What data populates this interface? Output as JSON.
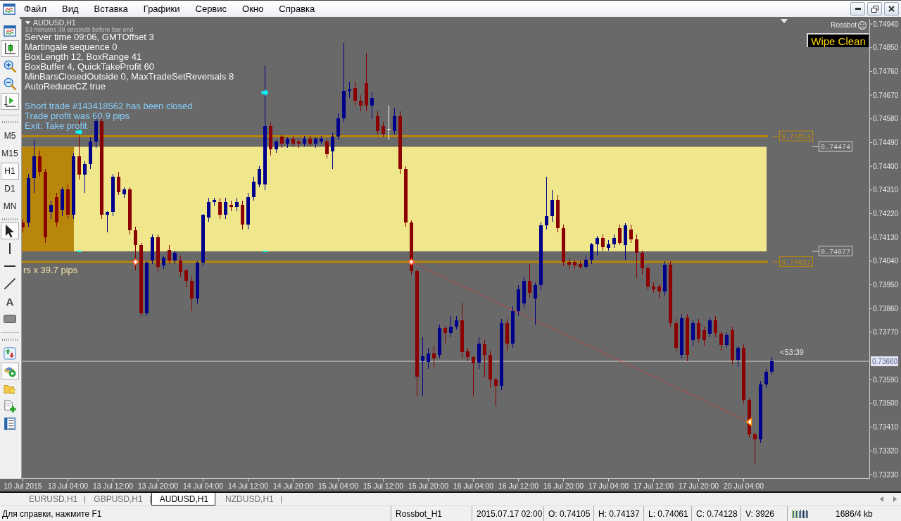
{
  "menu_bar": {
    "items": [
      "Файл",
      "Вид",
      "Вставка",
      "Графики",
      "Сервис",
      "Окно",
      "Справка"
    ]
  },
  "toolbar": {
    "chart_buttons": [
      {
        "kind": "window",
        "pressed": false
      },
      {
        "kind": "candles",
        "pressed": true
      },
      {
        "kind": "zoomin",
        "pressed": false
      },
      {
        "kind": "zoomout",
        "pressed": false
      },
      {
        "kind": "shift",
        "pressed": true
      }
    ],
    "timeframes": [
      {
        "label": "M5",
        "selected": false
      },
      {
        "label": "M15",
        "selected": false
      },
      {
        "label": "H1",
        "selected": true
      },
      {
        "label": "D1",
        "selected": false
      },
      {
        "label": "MN",
        "selected": false
      }
    ],
    "draw_tools": [
      {
        "kind": "cursor",
        "selected": true
      },
      {
        "kind": "vline",
        "selected": false
      },
      {
        "kind": "hline",
        "selected": false
      },
      {
        "kind": "trend",
        "selected": false
      },
      {
        "kind": "text",
        "label": "A",
        "selected": false
      },
      {
        "kind": "rect",
        "selected": false
      }
    ],
    "panel_buttons": [
      {
        "kind": "arrows",
        "pressed": false
      },
      {
        "kind": "tester",
        "pressed": true
      },
      {
        "kind": "favorites",
        "pressed": false
      },
      {
        "kind": "newdoc",
        "pressed": false
      },
      {
        "kind": "list",
        "pressed": false
      }
    ]
  },
  "chart": {
    "symbol": "AUDUSD,H1",
    "countdown": "53 minutes 38 seconds before bar end",
    "info_lines": [
      "Server time 09:06, GMTOffset 3",
      "Martingale sequence 0",
      "BoxLength 12, BoxRange 41",
      "BoxBuffer 4, QuickTakeProfit 60",
      "MinBarsClosedOutside 0, MaxTradeSetReversals 8",
      "AutoReduceCZ true"
    ],
    "trade_lines": [
      "Short trade #143418562 has been closed",
      "Trade profit was 60.9 pips",
      "Exit: Take profit"
    ],
    "box_note": "rs x 39.7 pips",
    "robot": "Rossbot",
    "wipe_button": "Wipe Clean",
    "bar_timer": "<53:39",
    "chart_data": [
      {
        "type": "candlestick",
        "ylim": [
          0.73214,
          0.74959
        ],
        "yticks": [
          {
            "value": 0.7494,
            "label": "0.74940"
          },
          {
            "value": 0.7485,
            "label": "0.74850"
          },
          {
            "value": 0.7476,
            "label": "0.74760"
          },
          {
            "value": 0.7467,
            "label": "0.74670"
          },
          {
            "value": 0.7458,
            "label": "0.74580"
          },
          {
            "value": 0.7449,
            "label": "0.74490"
          },
          {
            "value": 0.744,
            "label": "0.74400"
          },
          {
            "value": 0.7431,
            "label": "0.74310"
          },
          {
            "value": 0.7422,
            "label": "0.74220"
          },
          {
            "value": 0.7413,
            "label": "0.74130"
          },
          {
            "value": 0.7404,
            "label": "0.74040"
          },
          {
            "value": 0.7395,
            "label": "0.73950"
          },
          {
            "value": 0.7386,
            "label": "0.73860"
          },
          {
            "value": 0.7377,
            "label": "0.73770"
          },
          {
            "value": 0.7359,
            "label": "0.73590"
          },
          {
            "value": 0.735,
            "label": "0.73500"
          },
          {
            "value": 0.7341,
            "label": "0.73410"
          },
          {
            "value": 0.7332,
            "label": "0.73320"
          },
          {
            "value": 0.7323,
            "label": "0.73230"
          }
        ],
        "categories": [
          "10 Jul 2015",
          null,
          null,
          null,
          null,
          null,
          null,
          null,
          "13 Jul 04:00",
          null,
          null,
          null,
          null,
          null,
          null,
          null,
          "13 Jul 12:00",
          null,
          null,
          null,
          null,
          null,
          null,
          null,
          "13 Jul 20:00",
          null,
          null,
          null,
          null,
          null,
          null,
          null,
          "14 Jul 04:00",
          null,
          null,
          null,
          null,
          null,
          null,
          null,
          "14 Jul 12:00",
          null,
          null,
          null,
          null,
          null,
          null,
          null,
          "14 Jul 20:00",
          null,
          null,
          null,
          null,
          null,
          null,
          null,
          "15 Jul 04:00",
          null,
          null,
          null,
          null,
          null,
          null,
          null,
          "15 Jul 12:00",
          null,
          null,
          null,
          null,
          null,
          null,
          null,
          "15 Jul 20:00",
          null,
          null,
          null,
          null,
          null,
          null,
          null,
          "16 Jul 04:00",
          null,
          null,
          null,
          null,
          null,
          null,
          null,
          "16 Jul 12:00",
          null,
          null,
          null,
          null,
          null,
          null,
          null,
          "16 Jul 20:00",
          null,
          null,
          null,
          null,
          null,
          null,
          null,
          "17 Jul 04:00",
          null,
          null,
          null,
          null,
          null,
          null,
          null,
          "17 Jul 12:00",
          null,
          null,
          null,
          null,
          null,
          null,
          null,
          "17 Jul 20:00",
          null,
          null,
          null,
          null,
          null,
          null,
          null,
          "20 Jul 04:00",
          null,
          null,
          null,
          null,
          null,
          null,
          null,
          null,
          null,
          null,
          null,
          null,
          null,
          null,
          null,
          null,
          null,
          null,
          null,
          null,
          null,
          null,
          null,
          null,
          null,
          null,
          null
        ],
        "ohlc": [
          [
            0.74187,
            0.742,
            0.7415,
            0.74168
          ],
          [
            0.74187,
            0.7437,
            0.7417,
            0.74356
          ],
          [
            0.74356,
            0.745,
            0.743,
            0.74437
          ],
          [
            0.74437,
            0.7446,
            0.7436,
            0.74379
          ],
          [
            0.74379,
            0.7439,
            0.7411,
            0.7413
          ],
          [
            0.74226,
            0.7427,
            0.742,
            0.74254
          ],
          [
            0.74283,
            0.743,
            0.7417,
            0.74187
          ],
          [
            0.74235,
            0.7432,
            0.7421,
            0.74312
          ],
          [
            0.74312,
            0.7433,
            0.742,
            0.74216
          ],
          [
            0.74216,
            0.7445,
            0.742,
            0.74437
          ],
          [
            0.74437,
            0.74575,
            0.7435,
            0.74369
          ],
          [
            0.74369,
            0.7442,
            0.743,
            0.74408
          ],
          [
            0.74408,
            0.7451,
            0.7439,
            0.74494
          ],
          [
            0.74494,
            0.746,
            0.7447,
            0.74571
          ],
          [
            0.74571,
            0.7459,
            0.742,
            0.74216
          ],
          [
            0.74216,
            0.7423,
            0.74149,
            0.74226
          ],
          [
            0.74226,
            0.7437,
            0.7421,
            0.7436
          ],
          [
            0.7436,
            0.7438,
            0.7429,
            0.74302
          ],
          [
            0.74293,
            0.7432,
            0.7428,
            0.74312
          ],
          [
            0.74312,
            0.7432,
            0.7414,
            0.74158
          ],
          [
            0.74158,
            0.7417,
            0.74005,
            0.74101
          ],
          [
            0.74101,
            0.7411,
            0.7383,
            0.73842
          ],
          [
            0.73842,
            0.7404,
            0.7383,
            0.74034
          ],
          [
            0.74043,
            0.7414,
            0.7403,
            0.7413
          ],
          [
            0.7413,
            0.7414,
            0.74,
            0.74018
          ],
          [
            0.74024,
            0.7406,
            0.7401,
            0.74053
          ],
          [
            0.74082,
            0.741,
            0.7403,
            0.74043
          ],
          [
            0.74043,
            0.7408,
            0.7403,
            0.74072
          ],
          [
            0.74043,
            0.7406,
            0.7398,
            0.73999
          ],
          [
            0.74005,
            0.7401,
            0.7394,
            0.73966
          ],
          [
            0.73966,
            0.7398,
            0.7385,
            0.73899
          ],
          [
            0.73899,
            0.7404,
            0.7388,
            0.74034
          ],
          [
            0.74034,
            0.7422,
            0.7402,
            0.74216
          ],
          [
            0.74206,
            0.7428,
            0.7419,
            0.74264
          ],
          [
            0.74264,
            0.7428,
            0.7425,
            0.74273
          ],
          [
            0.74264,
            0.7428,
            0.742,
            0.74216
          ],
          [
            0.74216,
            0.7428,
            0.742,
            0.74264
          ],
          [
            0.74254,
            0.7427,
            0.7423,
            0.74245
          ],
          [
            0.74245,
            0.7428,
            0.7423,
            0.74264
          ],
          [
            0.74254,
            0.7427,
            0.7416,
            0.74178
          ],
          [
            0.74178,
            0.743,
            0.7416,
            0.74283
          ],
          [
            0.74283,
            0.7436,
            0.7427,
            0.74341
          ],
          [
            0.74331,
            0.744,
            0.7432,
            0.74389
          ],
          [
            0.74331,
            0.74782,
            0.7431,
            0.74552
          ],
          [
            0.74552,
            0.7457,
            0.7444,
            0.74465
          ],
          [
            0.74465,
            0.745,
            0.7445,
            0.74494
          ],
          [
            0.74513,
            0.7452,
            0.7447,
            0.74485
          ],
          [
            0.74485,
            0.7451,
            0.7447,
            0.74504
          ],
          [
            0.74504,
            0.74515,
            0.74475,
            0.74485
          ],
          [
            0.74494,
            0.74505,
            0.7447,
            0.74485
          ],
          [
            0.74485,
            0.74515,
            0.74475,
            0.74504
          ],
          [
            0.74504,
            0.74515,
            0.74475,
            0.74485
          ],
          [
            0.74485,
            0.7451,
            0.7447,
            0.74504
          ],
          [
            0.74494,
            0.74515,
            0.74485,
            0.74504
          ],
          [
            0.74494,
            0.74505,
            0.7443,
            0.74446
          ],
          [
            0.74456,
            0.74525,
            0.7439,
            0.74513
          ],
          [
            0.74513,
            0.746,
            0.745,
            0.74581
          ],
          [
            0.74581,
            0.74868,
            0.7457,
            0.74686
          ],
          [
            0.74686,
            0.7472,
            0.7466,
            0.74692
          ],
          [
            0.74696,
            0.7472,
            0.7463,
            0.74648
          ],
          [
            0.74648,
            0.7467,
            0.7461,
            0.74629
          ],
          [
            0.74715,
            0.7483,
            0.7461,
            0.74629
          ],
          [
            0.74629,
            0.7468,
            0.7458,
            0.7466
          ],
          [
            0.7459,
            0.7461,
            0.7452,
            0.74533
          ],
          [
            0.74552,
            0.7457,
            0.7451,
            0.74523
          ],
          [
            0.74542,
            0.7463,
            0.745,
            0.74542
          ],
          [
            0.74533,
            0.7462,
            0.7452,
            0.7459
          ],
          [
            0.7459,
            0.7461,
            0.7437,
            0.74389
          ],
          [
            0.74389,
            0.744,
            0.7417,
            0.74187
          ],
          [
            0.74188,
            0.74195,
            0.7399,
            0.74003
          ],
          [
            0.74003,
            0.7401,
            0.73527,
            0.73601
          ],
          [
            0.7366,
            0.7375,
            0.73527,
            0.7368
          ],
          [
            0.73657,
            0.7371,
            0.7363,
            0.7369
          ],
          [
            0.7369,
            0.7372,
            0.7364,
            0.7367
          ],
          [
            0.73684,
            0.738,
            0.7367,
            0.73786
          ],
          [
            0.73786,
            0.73795,
            0.7373,
            0.73768
          ],
          [
            0.73768,
            0.7383,
            0.7375,
            0.7379
          ],
          [
            0.7379,
            0.7383,
            0.7378,
            0.73814
          ],
          [
            0.73814,
            0.73883,
            0.7367,
            0.73694
          ],
          [
            0.73697,
            0.7371,
            0.7366,
            0.73675
          ],
          [
            0.73675,
            0.7368,
            0.73527,
            0.73653
          ],
          [
            0.73656,
            0.7375,
            0.7363,
            0.73727
          ],
          [
            0.73725,
            0.7374,
            0.736,
            0.73684
          ],
          [
            0.73684,
            0.737,
            0.7356,
            0.73592
          ],
          [
            0.73592,
            0.736,
            0.7349,
            0.73568
          ],
          [
            0.73568,
            0.7382,
            0.7355,
            0.73805
          ],
          [
            0.73805,
            0.7382,
            0.737,
            0.73727
          ],
          [
            0.73727,
            0.7387,
            0.7371,
            0.73851
          ],
          [
            0.73851,
            0.7395,
            0.7383,
            0.73934
          ],
          [
            0.7388,
            0.7398,
            0.7386,
            0.73966
          ],
          [
            0.73966,
            0.7403,
            0.739,
            0.7392
          ],
          [
            0.73897,
            0.7396,
            0.738,
            0.73949
          ],
          [
            0.73949,
            0.7419,
            0.7393,
            0.74175
          ],
          [
            0.74175,
            0.7436,
            0.7416,
            0.74212
          ],
          [
            0.74212,
            0.7431,
            0.7419,
            0.74271
          ],
          [
            0.74271,
            0.7429,
            0.7415,
            0.74166
          ],
          [
            0.74166,
            0.7418,
            0.7402,
            0.74036
          ],
          [
            0.74036,
            0.7405,
            0.7401,
            0.74027
          ],
          [
            0.74036,
            0.74045,
            0.7401,
            0.74023
          ],
          [
            0.7403,
            0.7404,
            0.7401,
            0.74018
          ],
          [
            0.74018,
            0.7406,
            0.7401,
            0.74045
          ],
          [
            0.74045,
            0.7411,
            0.7403,
            0.74105
          ],
          [
            0.74105,
            0.74137,
            0.74061,
            0.74128
          ],
          [
            0.74129,
            0.7414,
            0.7408,
            0.74092
          ],
          [
            0.7409,
            0.7412,
            0.7408,
            0.74105
          ],
          [
            0.74105,
            0.7414,
            0.7409,
            0.74129
          ],
          [
            0.74166,
            0.7418,
            0.741,
            0.7411
          ],
          [
            0.74101,
            0.74185,
            0.74045,
            0.74175
          ],
          [
            0.7416,
            0.7418,
            0.7411,
            0.74123
          ],
          [
            0.74123,
            0.7414,
            0.73975,
            0.74073
          ],
          [
            0.74073,
            0.7408,
            0.7399,
            0.74012
          ],
          [
            0.74012,
            0.7402,
            0.7393,
            0.73944
          ],
          [
            0.73944,
            0.7396,
            0.7392,
            0.73934
          ],
          [
            0.73944,
            0.73955,
            0.73897,
            0.73925
          ],
          [
            0.73925,
            0.7404,
            0.7391,
            0.74027
          ],
          [
            0.74027,
            0.7404,
            0.7379,
            0.73805
          ],
          [
            0.73805,
            0.7382,
            0.737,
            0.73712
          ],
          [
            0.73684,
            0.7384,
            0.7367,
            0.73823
          ],
          [
            0.73827,
            0.7384,
            0.7366,
            0.73684
          ],
          [
            0.7374,
            0.73815,
            0.7372,
            0.73805
          ],
          [
            0.73805,
            0.7382,
            0.7373,
            0.73746
          ],
          [
            0.73777,
            0.7379,
            0.7372,
            0.7374
          ],
          [
            0.73764,
            0.73825,
            0.7375,
            0.73814
          ],
          [
            0.73814,
            0.7383,
            0.7375,
            0.73768
          ],
          [
            0.73764,
            0.73775,
            0.737,
            0.73721
          ],
          [
            0.73721,
            0.7377,
            0.7371,
            0.73758
          ],
          [
            0.73777,
            0.7379,
            0.7365,
            0.73666
          ],
          [
            0.73666,
            0.7372,
            0.7364,
            0.73712
          ],
          [
            0.73712,
            0.73725,
            0.735,
            0.73512
          ],
          [
            0.73512,
            0.7352,
            0.7337,
            0.73382
          ],
          [
            0.73382,
            0.7339,
            0.73268,
            0.73364
          ],
          [
            0.73364,
            0.73585,
            0.7335,
            0.73573
          ],
          [
            0.73573,
            0.7363,
            0.7356,
            0.7362
          ],
          [
            0.7362,
            0.73675,
            0.7361,
            0.7366
          ],
          null,
          null,
          null,
          null,
          null,
          null,
          null,
          null,
          null,
          null,
          null,
          null,
          null,
          null,
          null,
          null,
          null,
          null,
          null,
          null,
          null,
          null
        ],
        "bands": [
          {
            "axis": "y",
            "from": 0.74077,
            "to": 0.74474,
            "color": "#f0e68c"
          }
        ],
        "ref_lines": [
          {
            "axis": "y",
            "value": 0.74514,
            "label": "0.74514",
            "color": "#b8860b",
            "line_style": "solid"
          },
          {
            "axis": "y",
            "value": 0.74474,
            "label": "0.74474",
            "color": "#d0d0d0",
            "line_style": "solid"
          },
          {
            "axis": "y",
            "value": 0.74077,
            "label": "0.74077",
            "color": "#d0d0d0",
            "line_style": "solid"
          },
          {
            "axis": "y",
            "value": 0.74037,
            "label": "0.74037",
            "color": "#b8860b",
            "line_style": "solid"
          },
          {
            "axis": "y",
            "value": 0.7366,
            "label": "0.73660",
            "color": "#c8c8c8",
            "line_style": "solid"
          }
        ],
        "series": [
          {
            "type": "line",
            "color": "#ff2a2a",
            "line_style": "dotted",
            "values": [
              null,
              null,
              null,
              null,
              null,
              null,
              null,
              null,
              null,
              null,
              null,
              null,
              null,
              null,
              null,
              null,
              null,
              null,
              null,
              null,
              null,
              null,
              null,
              null,
              null,
              null,
              null,
              null,
              null,
              null,
              null,
              null,
              null,
              null,
              null,
              null,
              null,
              null,
              null,
              null,
              null,
              null,
              null,
              null,
              null,
              null,
              null,
              null,
              null,
              null,
              null,
              null,
              null,
              null,
              null,
              null,
              null,
              null,
              null,
              null,
              null,
              null,
              null,
              null,
              null,
              null,
              null,
              null,
              null,
              0.74037,
              0.74027,
              0.74017,
              0.74007,
              0.73997,
              0.73986,
              0.73976,
              0.73966,
              0.73956,
              0.73946,
              0.73936,
              0.73926,
              0.73916,
              0.73905,
              0.73895,
              0.73885,
              0.73875,
              0.73865,
              0.73855,
              0.73845,
              0.73835,
              0.73824,
              0.73814,
              0.73804,
              0.73794,
              0.73784,
              0.73774,
              0.73764,
              0.73754,
              0.73743,
              0.73733,
              0.73723,
              0.73713,
              0.73703,
              0.73693,
              0.73683,
              0.73673,
              0.73662,
              0.73652,
              0.73642,
              0.73632,
              0.73622,
              0.73612,
              0.73602,
              0.73592,
              0.73581,
              0.73571,
              0.73561,
              0.73551,
              0.73541,
              0.73531,
              0.73521,
              0.73511,
              0.735,
              0.7349,
              0.7348,
              0.7347,
              0.7346,
              0.7345,
              0.7344,
              0.7343,
              null,
              null,
              null,
              null,
              null,
              null,
              null,
              null,
              null,
              null,
              null,
              null,
              null,
              null,
              null,
              null,
              null,
              null,
              null,
              null,
              null,
              null,
              null,
              null,
              null,
              null
            ]
          },
          {
            "type": "scatter",
            "color": "#00ffff",
            "values": [
              null,
              null,
              null,
              null,
              null,
              null,
              null,
              null,
              null,
              null,
              0.7453,
              null,
              null,
              null,
              null,
              null,
              null,
              null,
              null,
              null,
              null,
              null,
              null,
              null,
              null,
              null,
              null,
              null,
              null,
              null,
              null,
              null,
              null,
              null,
              null,
              null,
              null,
              null,
              null,
              null,
              null,
              null,
              null,
              0.7468,
              null,
              null,
              null,
              null,
              null,
              null,
              null,
              null,
              null,
              null,
              null,
              null,
              null,
              null,
              null,
              null,
              null,
              null,
              null,
              null,
              null,
              null,
              null,
              null,
              null,
              null,
              null,
              null,
              null,
              null,
              null,
              null,
              null,
              null,
              null,
              null,
              null,
              null,
              null,
              null,
              null,
              null,
              null,
              null,
              null,
              null,
              null,
              null,
              null,
              null,
              null,
              null,
              null,
              null,
              null,
              null,
              null,
              null,
              null,
              null,
              null,
              null,
              null,
              null,
              null,
              null,
              null,
              null,
              null,
              null,
              null,
              null,
              null,
              null,
              null,
              null,
              null,
              null,
              null,
              null,
              null,
              null,
              null,
              null,
              null,
              null,
              null,
              null,
              null,
              null,
              null,
              null,
              null,
              null,
              null,
              null,
              null,
              null,
              null,
              null,
              null,
              null,
              null,
              null,
              null,
              null,
              null,
              null,
              null,
              null,
              null,
              null
            ]
          },
          {
            "type": "scatter",
            "marker": "square",
            "color": "#00ffff",
            "values": [
              null,
              null,
              null,
              null,
              null,
              null,
              null,
              null,
              null,
              null,
              0.74077,
              null,
              null,
              null,
              null,
              null,
              null,
              null,
              null,
              null,
              null,
              null,
              null,
              null,
              null,
              null,
              null,
              null,
              null,
              null,
              null,
              null,
              null,
              null,
              null,
              null,
              null,
              null,
              null,
              null,
              null,
              null,
              null,
              0.74077,
              null,
              null,
              null,
              null,
              null,
              null,
              null,
              null,
              null,
              null,
              null,
              null,
              null,
              null,
              null,
              null,
              null,
              null,
              null,
              null,
              null,
              null,
              null,
              null,
              null,
              null,
              null,
              null,
              null,
              null,
              null,
              null,
              null,
              null,
              null,
              null,
              null,
              null,
              null,
              null,
              null,
              null,
              null,
              null,
              null,
              null,
              null,
              null,
              null,
              null,
              null,
              null,
              null,
              null,
              null,
              null,
              null,
              null,
              null,
              null,
              null,
              null,
              null,
              null,
              null,
              null,
              null,
              null,
              null,
              null,
              null,
              null,
              null,
              null,
              null,
              null,
              null,
              null,
              null,
              null,
              null,
              null,
              null,
              null,
              null,
              null,
              null,
              null,
              null,
              null,
              null,
              null,
              null,
              null,
              null,
              null,
              null,
              null,
              null,
              null,
              null,
              null,
              null,
              null,
              null,
              null,
              null,
              null,
              null,
              null,
              null,
              null
            ]
          },
          {
            "type": "scatter",
            "marker": "diamond",
            "color": "#ff5a1e",
            "values": [
              null,
              null,
              null,
              null,
              null,
              null,
              null,
              null,
              null,
              null,
              null,
              null,
              null,
              null,
              null,
              null,
              null,
              null,
              null,
              null,
              0.74037,
              null,
              null,
              null,
              null,
              null,
              null,
              null,
              null,
              null,
              null,
              null,
              null,
              null,
              null,
              null,
              null,
              null,
              null,
              null,
              null,
              null,
              null,
              null,
              null,
              null,
              null,
              null,
              null,
              null,
              null,
              null,
              null,
              null,
              null,
              null,
              null,
              null,
              null,
              null,
              null,
              null,
              null,
              null,
              null,
              null,
              null,
              null,
              null,
              0.74037,
              null,
              null,
              null,
              null,
              null,
              null,
              null,
              null,
              null,
              null,
              null,
              null,
              null,
              null,
              null,
              null,
              null,
              null,
              null,
              null,
              null,
              null,
              null,
              null,
              null,
              null,
              null,
              null,
              null,
              null,
              null,
              null,
              null,
              null,
              null,
              null,
              null,
              null,
              null,
              null,
              null,
              null,
              null,
              null,
              null,
              null,
              null,
              null,
              null,
              null,
              null,
              null,
              null,
              null,
              null,
              null,
              null,
              null,
              null,
              null,
              null,
              null,
              null,
              null,
              null,
              null,
              null,
              null,
              null,
              null,
              null,
              null,
              null,
              null,
              null,
              null,
              null,
              null,
              null,
              null,
              null,
              null,
              null,
              null,
              null,
              null
            ]
          },
          {
            "type": "scatter",
            "marker": "triangle",
            "color": "#ff8c00",
            "values": [
              null,
              null,
              null,
              null,
              null,
              null,
              null,
              null,
              null,
              null,
              null,
              null,
              null,
              null,
              null,
              null,
              null,
              null,
              null,
              null,
              null,
              null,
              null,
              null,
              null,
              null,
              null,
              null,
              null,
              null,
              null,
              null,
              null,
              null,
              null,
              null,
              null,
              null,
              null,
              null,
              null,
              null,
              null,
              null,
              null,
              null,
              null,
              null,
              null,
              null,
              null,
              null,
              null,
              null,
              null,
              null,
              null,
              null,
              null,
              null,
              null,
              null,
              null,
              null,
              null,
              null,
              null,
              null,
              null,
              null,
              null,
              null,
              null,
              null,
              null,
              null,
              null,
              null,
              null,
              null,
              null,
              null,
              null,
              null,
              null,
              null,
              null,
              null,
              null,
              null,
              null,
              null,
              null,
              null,
              null,
              null,
              null,
              null,
              null,
              null,
              null,
              null,
              null,
              null,
              null,
              null,
              null,
              null,
              null,
              null,
              null,
              null,
              null,
              null,
              null,
              null,
              null,
              null,
              null,
              null,
              null,
              null,
              null,
              null,
              null,
              null,
              null,
              null,
              null,
              0.7343,
              null,
              null,
              null,
              null,
              null,
              null,
              null,
              null,
              null,
              null,
              null,
              null,
              null,
              null,
              null,
              null,
              null,
              null,
              null,
              null,
              null,
              null,
              null,
              null,
              null,
              null
            ]
          }
        ]
      }
    ]
  },
  "tabs": [
    {
      "label": "EURUSD,H1",
      "selected": false
    },
    {
      "label": "GBPUSD,H1",
      "selected": false
    },
    {
      "label": "AUDUSD,H1",
      "selected": true
    },
    {
      "label": "NZDUSD,H1",
      "selected": false
    }
  ],
  "status_bar": {
    "help": "Для справки, нажмите F1",
    "profile": "Rossbot_H1",
    "bar_time": "2015.07.17 02:00",
    "open": "O: 0.74105",
    "high": "H: 0.74137",
    "low": "L: 0.74061",
    "close": "C: 0.74128",
    "volume": "V: 3926",
    "traffic": "1686/4 kb"
  }
}
